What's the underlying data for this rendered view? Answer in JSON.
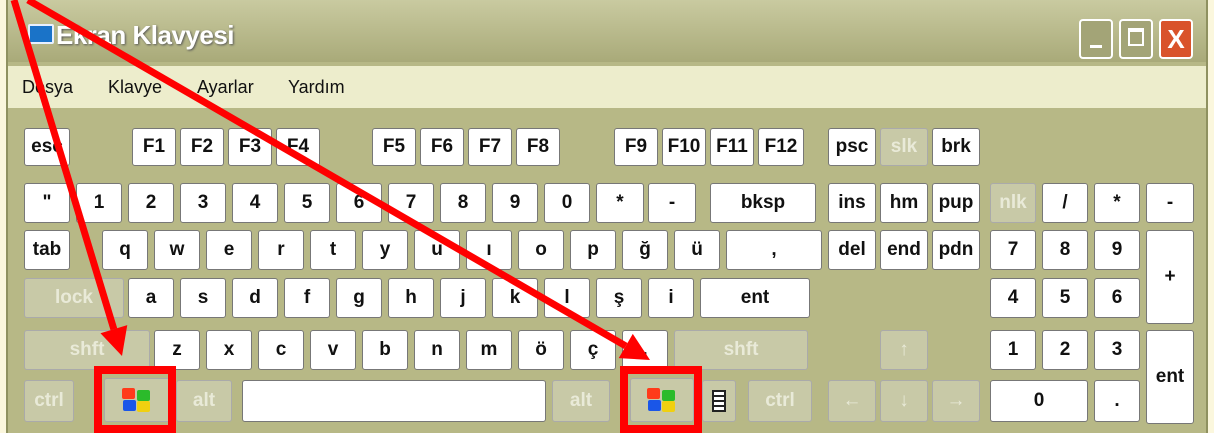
{
  "title": "Ekran Klavyesi",
  "window_buttons": {
    "close": "X"
  },
  "menu": [
    "Dosya",
    "Klavye",
    "Ayarlar",
    "Yardım"
  ],
  "keys": {
    "r0": [
      "esc",
      "F1",
      "F2",
      "F3",
      "F4",
      "F5",
      "F6",
      "F7",
      "F8",
      "F9",
      "F10",
      "F11",
      "F12",
      "psc",
      "slk",
      "brk"
    ],
    "r1": [
      "\"",
      "1",
      "2",
      "3",
      "4",
      "5",
      "6",
      "7",
      "8",
      "9",
      "0",
      "*",
      "-",
      "bksp",
      "ins",
      "hm",
      "pup",
      "nlk",
      "/",
      "*",
      "-"
    ],
    "r2": [
      "tab",
      "q",
      "w",
      "e",
      "r",
      "t",
      "y",
      "u",
      "ı",
      "o",
      "p",
      "ğ",
      "ü",
      ",",
      "del",
      "end",
      "pdn",
      "7",
      "8",
      "9",
      "+"
    ],
    "r3": [
      "lock",
      "a",
      "s",
      "d",
      "f",
      "g",
      "h",
      "j",
      "k",
      "l",
      "ş",
      "i",
      "ent",
      "4",
      "5",
      "6"
    ],
    "r4": [
      "shft",
      "z",
      "x",
      "c",
      "v",
      "b",
      "n",
      "m",
      "ö",
      "ç",
      ".",
      "shft",
      "↑",
      "1",
      "2",
      "3",
      "ent"
    ],
    "r5": [
      "ctrl",
      "alt",
      "alt",
      "ctrl",
      "←",
      "↓",
      "→",
      "0",
      "."
    ]
  },
  "colors": {
    "highlight": "#ff0000",
    "arrow": "#ff0000",
    "window": "#b7b886",
    "key": "#ffffff"
  }
}
